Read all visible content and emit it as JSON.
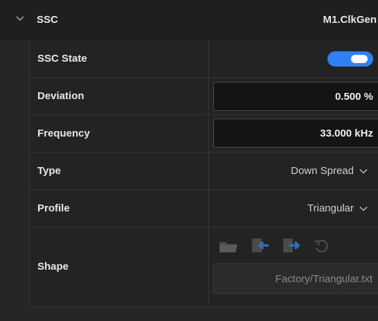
{
  "header": {
    "title": "SSC",
    "source": "M1.ClkGen"
  },
  "rows": {
    "ssc_state": {
      "label": "SSC State",
      "enabled": true
    },
    "deviation": {
      "label": "Deviation",
      "value": "0.500 %"
    },
    "frequency": {
      "label": "Frequency",
      "value": "33.000 kHz"
    },
    "type": {
      "label": "Type",
      "value": "Down Spread"
    },
    "profile": {
      "label": "Profile",
      "value": "Triangular"
    },
    "shape": {
      "label": "Shape",
      "file": "Factory/Triangular.txt",
      "actions": [
        "open-folder-icon",
        "import-icon",
        "export-icon",
        "reset-icon"
      ]
    }
  },
  "colors": {
    "accent": "#2f7ff5",
    "background": "#252526",
    "text": "#e8e8e8",
    "muted": "#8a8a8a"
  }
}
